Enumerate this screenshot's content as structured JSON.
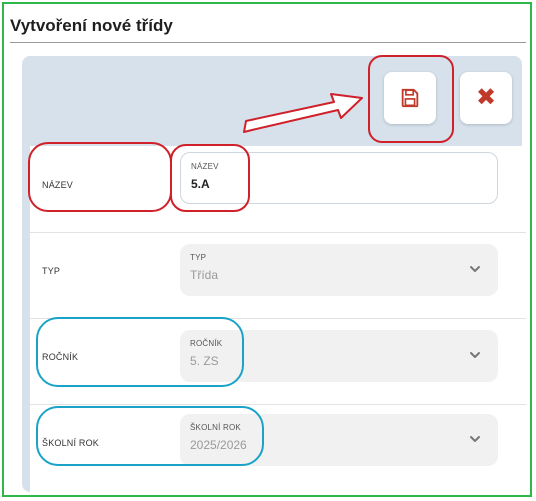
{
  "dialog": {
    "title": "Vytvoření nové třídy"
  },
  "toolbar": {
    "save_icon": "save-icon",
    "close_icon": "close-icon",
    "close_glyph": "✖"
  },
  "form": {
    "rows": [
      {
        "row_label": "NÁZEV",
        "field_label": "NÁZEV",
        "value": "5.A",
        "editable": true
      },
      {
        "row_label": "TYP",
        "field_label": "TYP",
        "value": "Třída",
        "editable": false
      },
      {
        "row_label": "ROČNÍK",
        "field_label": "ROČNÍK",
        "value": "5. ZS",
        "editable": false
      },
      {
        "row_label": "ŠKOLNÍ ROK",
        "field_label": "ŠKOLNÍ ROK",
        "value": "2025/2026",
        "editable": false
      }
    ]
  },
  "colors": {
    "frame_border": "#2fb84a",
    "panel_background": "#d6e1ec",
    "annotation_red": "#d0202a",
    "annotation_blue": "#1aa3c8",
    "close_icon": "#c0392b"
  }
}
